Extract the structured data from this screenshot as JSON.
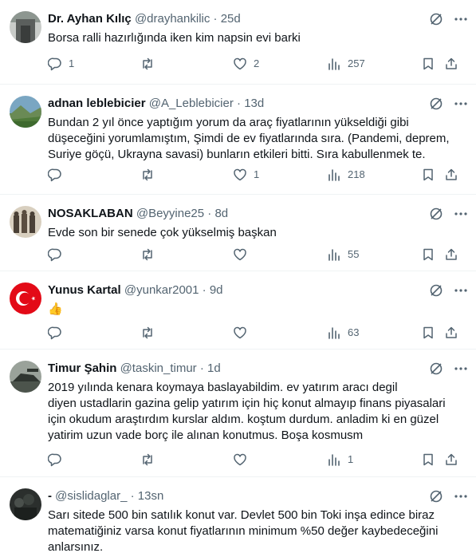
{
  "tweets": [
    {
      "name": "Dr. Ayhan Kılıç",
      "handle": "@drayhankilic",
      "sep": "·",
      "time": "25d",
      "text": "Borsa ralli hazırlığında iken kim napsin evi barki",
      "replies": "1",
      "retweets": "",
      "likes": "2",
      "views": "257"
    },
    {
      "name": "adnan leblebicier",
      "handle": "@A_Leblebicier",
      "sep": "·",
      "time": "13d",
      "text": "Bundan 2 yıl önce yaptığım yorum da araç fiyatlarının yükseldiği gibi\ndüşeceğini yorumlamıştım, Şimdi de ev fiyatlarında sıra. (Pandemi, deprem,\nSuriye göçü, Ukrayna savasi) bunların etkileri bitti. Sıra kabullenmek te.",
      "replies": "",
      "retweets": "",
      "likes": "1",
      "views": "218"
    },
    {
      "name": "NOSAKLABAN",
      "handle": "@Beyyine25",
      "sep": "·",
      "time": "8d",
      "text": "Evde son bir senede çok yükselmiş başkan",
      "replies": "",
      "retweets": "",
      "likes": "",
      "views": "55"
    },
    {
      "name": "Yunus Kartal",
      "handle": "@yunkar2001",
      "sep": "·",
      "time": "9d",
      "text": "👍",
      "replies": "",
      "retweets": "",
      "likes": "",
      "views": "63"
    },
    {
      "name": "Timur Şahin",
      "handle": "@taskin_timur",
      "sep": "·",
      "time": "1d",
      "text": "2019 yılında kenara koymaya baslayabildim. ev yatırım aracı degil\ndiyen ustadlarin gazina gelip yatırım için hiç konut almayıp finans piyasalari\niçin okudum araştırdım kurslar aldım. koştum durdum. anladim ki en güzel\nyatirim uzun vade borç ile alınan konutmus. Boşa kosmusm",
      "replies": "",
      "retweets": "",
      "likes": "",
      "views": "1"
    },
    {
      "name": "-",
      "handle": "@sislidaglar_",
      "sep": "·",
      "time": "13sn",
      "text": "Sarı sitede 500 bin satılık konut var. Devlet 500 bin Toki inşa edince biraz\nmatematiğiniz varsa konut fiyatlarının minimum %50 değer kaybedeceğini\nanlarsınız."
    }
  ],
  "icons": {
    "grok": "grok-icon",
    "more": "more-icon",
    "reply": "reply-icon",
    "retweet": "retweet-icon",
    "like": "like-icon",
    "views": "views-icon",
    "bookmark": "bookmark-icon",
    "share": "share-icon"
  },
  "colors": {
    "text": "#0f1419",
    "secondary": "#536471",
    "divider": "#eff3f4"
  }
}
